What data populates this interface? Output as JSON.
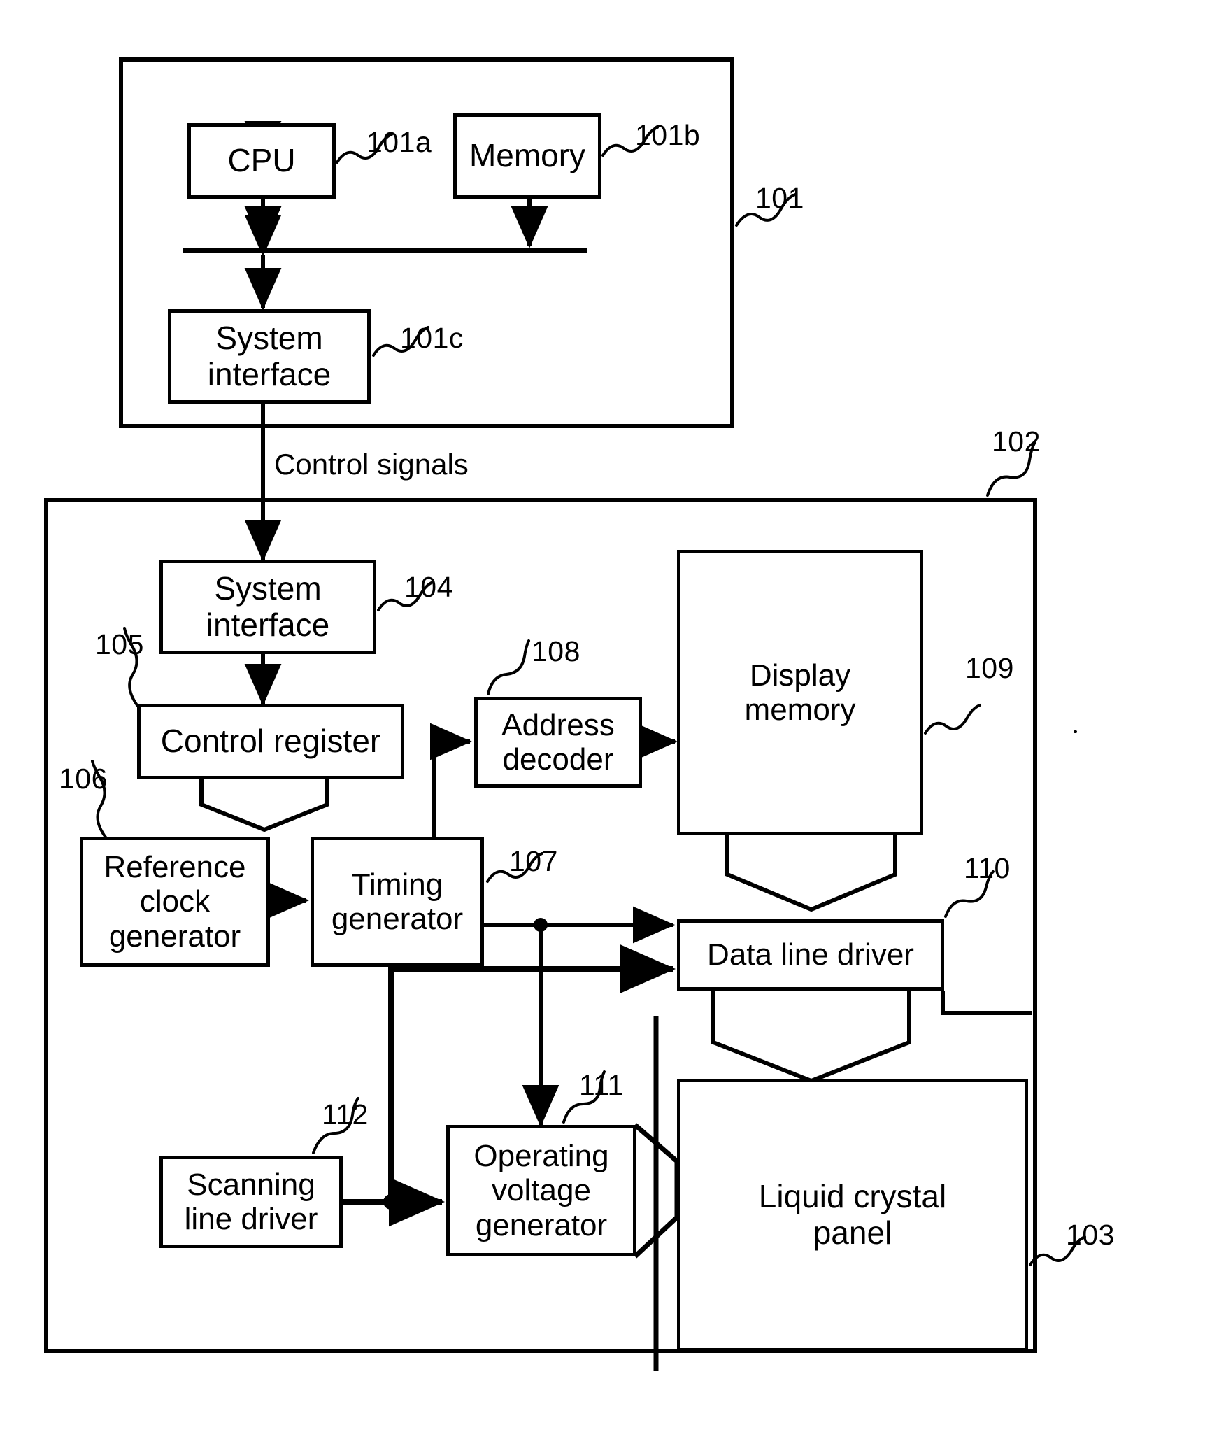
{
  "figure": {
    "type": "patent-block-diagram",
    "subject": "Liquid crystal display system block diagram"
  },
  "outer_blocks": [
    {
      "id": "101",
      "ref": "101",
      "name": "host-system-enclosure"
    },
    {
      "id": "102",
      "ref": "102",
      "name": "display-controller-enclosure"
    }
  ],
  "blocks": [
    {
      "id": "cpu",
      "label": "CPU",
      "ref": "101a"
    },
    {
      "id": "memory",
      "label": "Memory",
      "ref": "101b"
    },
    {
      "id": "sys_if_host",
      "label": "System\ninterface",
      "ref": "101c"
    },
    {
      "id": "sys_if_ctrl",
      "label": "System\ninterface",
      "ref": "104"
    },
    {
      "id": "control_reg",
      "label": "Control register",
      "ref": "105"
    },
    {
      "id": "ref_clock",
      "label": "Reference\nclock\ngenerator",
      "ref": "106"
    },
    {
      "id": "timing_gen",
      "label": "Timing\ngenerator",
      "ref": "107"
    },
    {
      "id": "addr_decoder",
      "label": "Address\ndecoder",
      "ref": "108"
    },
    {
      "id": "display_mem",
      "label": "Display\nmemory",
      "ref": "109"
    },
    {
      "id": "data_driver",
      "label": "Data line driver",
      "ref": "110"
    },
    {
      "id": "op_volt_gen",
      "label": "Operating\nvoltage\ngenerator",
      "ref": "111"
    },
    {
      "id": "scan_driver",
      "label": "Scanning\nline driver",
      "ref": "112"
    },
    {
      "id": "lcd_panel",
      "label": "Liquid crystal\npanel",
      "ref": "103"
    }
  ],
  "annotations": {
    "control_signals": "Control signals"
  },
  "refs": {
    "r101": "101",
    "r101a": "101a",
    "r101b": "101b",
    "r101c": "101c",
    "r102": "102",
    "r103": "103",
    "r104": "104",
    "r105": "105",
    "r106": "106",
    "r107": "107",
    "r108": "108",
    "r109": "109",
    "r110": "110",
    "r111": "111",
    "r112": "112"
  },
  "colors": {
    "line": "#000000",
    "background": "#ffffff"
  }
}
